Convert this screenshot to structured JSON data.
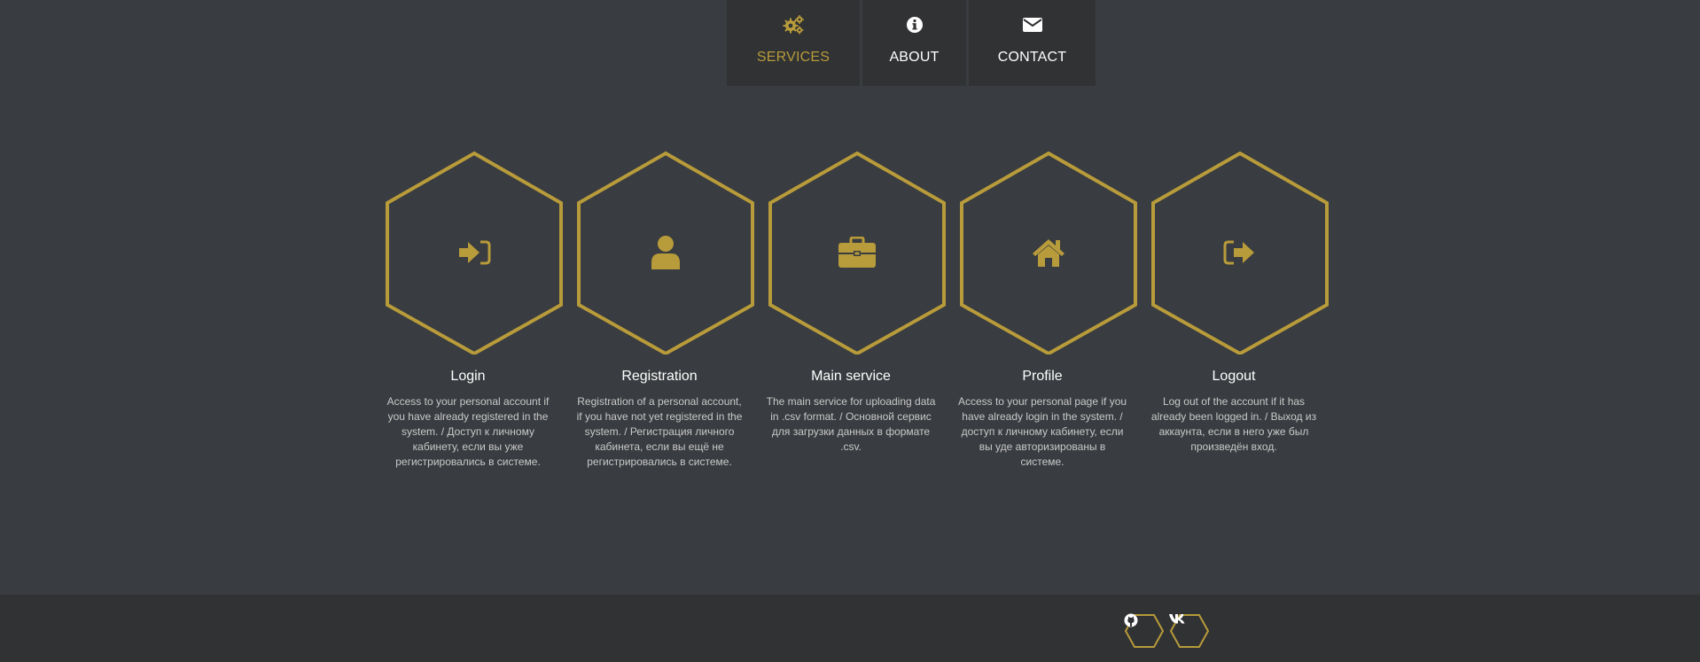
{
  "nav": {
    "items": [
      {
        "label": "SERVICES",
        "icon": "gears-icon",
        "active": true
      },
      {
        "label": "ABOUT",
        "icon": "info-circle-icon",
        "active": false
      },
      {
        "label": "CONTACT",
        "icon": "envelope-icon",
        "active": false
      }
    ]
  },
  "services": [
    {
      "title": "Login",
      "icon": "sign-in-icon",
      "description": "Access to your personal account if you have already registered in the system. / Доступ к личному кабинету, если вы уже регистрировались в системе."
    },
    {
      "title": "Registration",
      "icon": "user-icon",
      "description": "Registration of a personal account, if you have not yet registered in the system. / Регистрация личного кабинета, если вы ещё не регистрировались в системе."
    },
    {
      "title": "Main service",
      "icon": "briefcase-icon",
      "description": "The main service for uploading data in .csv format. / Основной сервис для загрузки данных в формате .csv."
    },
    {
      "title": "Profile",
      "icon": "home-icon",
      "description": "Access to your personal page if you have already login in the system. / доступ к личному кабинету, если вы уде авторизированы в системе."
    },
    {
      "title": "Logout",
      "icon": "sign-out-icon",
      "description": "Log out of the account if it has already been logged in. / Выход из аккаунта, если в него уже был произведён вход."
    }
  ],
  "footer": {
    "social": [
      {
        "icon": "github-icon"
      },
      {
        "icon": "vk-icon"
      }
    ]
  },
  "colors": {
    "accent": "#b89b3a",
    "background": "#393c40",
    "panel": "#313234",
    "text": "#ffffff",
    "muted_text": "#c9c9c9"
  }
}
